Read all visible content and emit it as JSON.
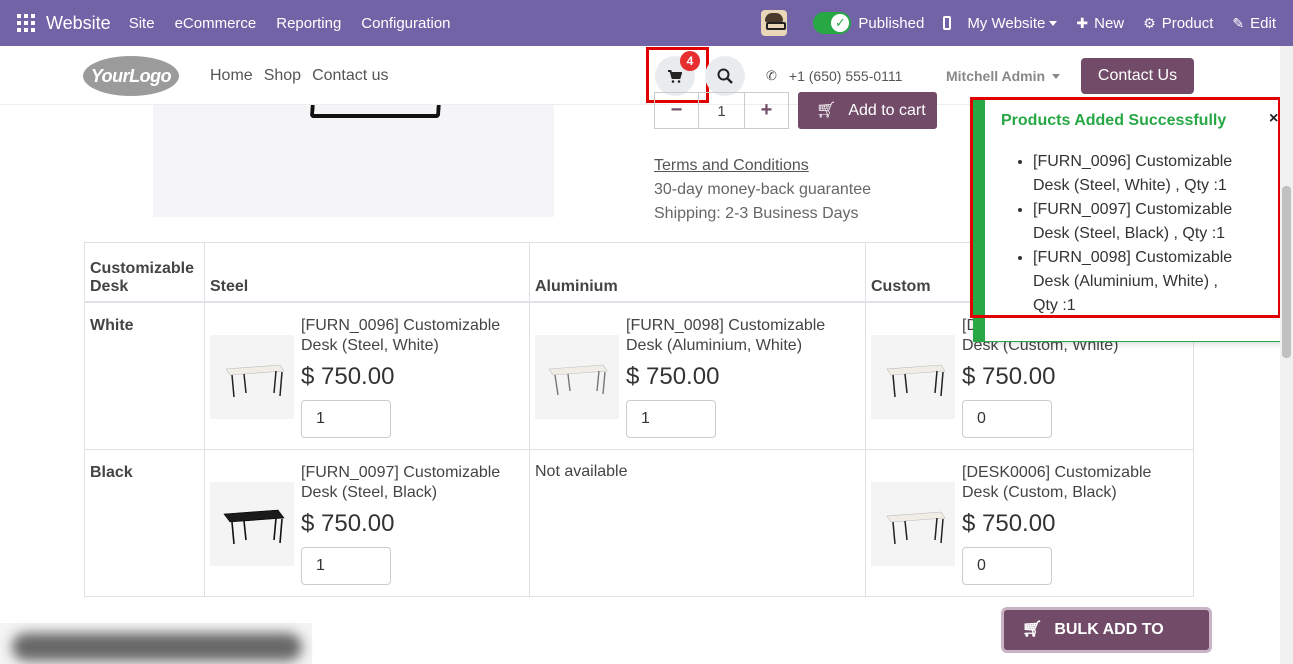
{
  "adminbar": {
    "brand": "Website",
    "menus": [
      "Site",
      "eCommerce",
      "Reporting",
      "Configuration"
    ],
    "published_label": "Published",
    "website_label": "My Website",
    "new_label": "New",
    "product_label": "Product",
    "edit_label": "Edit"
  },
  "header": {
    "logo_text": "YourLogo",
    "nav": [
      "Home",
      "Shop",
      "Contact us"
    ],
    "cart_count": "4",
    "phone": "+1 (650) 555-0111",
    "user": "Mitchell Admin",
    "contact_button": "Contact Us"
  },
  "product": {
    "quantity": "1",
    "add_to_cart_label": "Add to cart",
    "terms_label": "Terms and Conditions",
    "guarantee": "30-day money-back guarantee",
    "shipping": "Shipping: 2-3 Business Days"
  },
  "toast": {
    "title": "Products Added Successfully",
    "close": "×",
    "items": [
      "[FURN_0096] Customizable Desk (Steel, White) , Qty :1",
      "[FURN_0097] Customizable Desk (Steel, Black) , Qty :1",
      "[FURN_0098] Customizable Desk (Aluminium, White) , Qty :1"
    ]
  },
  "variants": {
    "corner_header": "Customizable Desk",
    "columns": [
      "Steel",
      "Aluminium",
      "Custom"
    ],
    "rows": [
      {
        "label": "White",
        "cells": [
          {
            "name": "[FURN_0096] Customizable Desk (Steel, White)",
            "price": "$ 750.00",
            "qty": "1",
            "thumb": "white-desk"
          },
          {
            "name": "[FURN_0098] Customizable Desk (Aluminium, White)",
            "price": "$ 750.00",
            "qty": "1",
            "thumb": "white-desk"
          },
          {
            "name": "[DESK0005] Customizable Desk (Custom, White)",
            "price": "$ 750.00",
            "qty": "0",
            "thumb": "white-desk"
          }
        ]
      },
      {
        "label": "Black",
        "cells": [
          {
            "name": "[FURN_0097] Customizable Desk (Steel, Black)",
            "price": "$ 750.00",
            "qty": "1",
            "thumb": "black-desk"
          },
          {
            "na": "Not available"
          },
          {
            "name": "[DESK0006] Customizable Desk (Custom, Black)",
            "price": "$ 750.00",
            "qty": "0",
            "thumb": "white-desk"
          }
        ]
      }
    ]
  },
  "bulk_add_label": "BULK ADD TO CART",
  "colors": {
    "admin_bar": "#7163a6",
    "brand_primary": "#714b67",
    "success": "#28a745",
    "highlight": "#e00000"
  }
}
